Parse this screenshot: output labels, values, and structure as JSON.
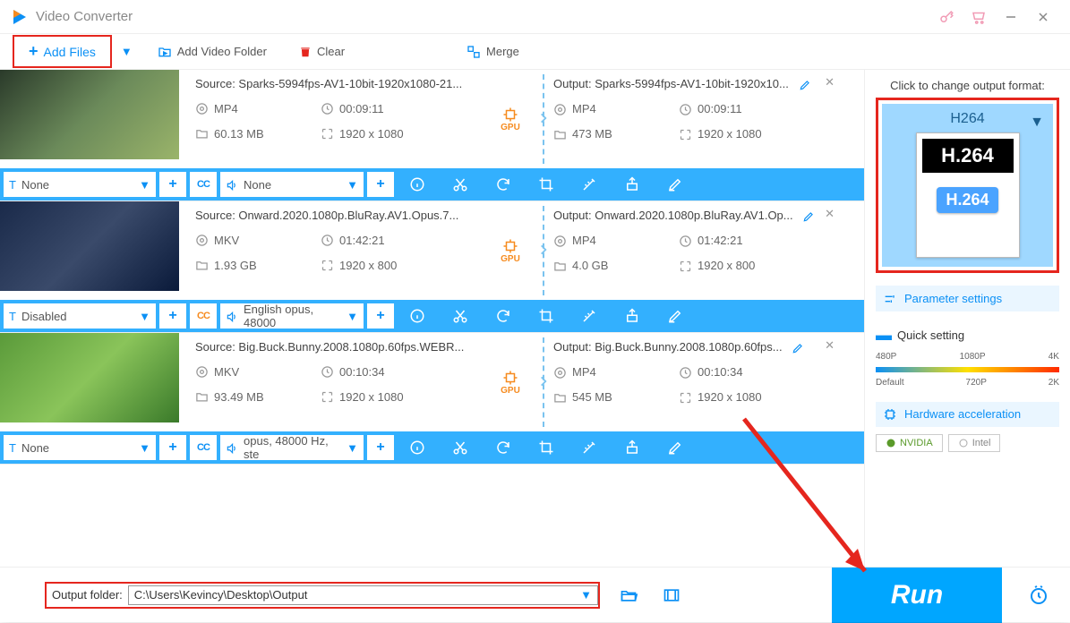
{
  "app": {
    "title": "Video Converter"
  },
  "toolbar": {
    "addFiles": "Add Files",
    "addFolder": "Add Video Folder",
    "clear": "Clear",
    "merge": "Merge"
  },
  "items": [
    {
      "source": {
        "label": "Source: Sparks-5994fps-AV1-10bit-1920x1080-21...",
        "format": "MP4",
        "duration": "00:09:11",
        "size": "60.13 MB",
        "res": "1920 x 1080"
      },
      "output": {
        "label": "Output: Sparks-5994fps-AV1-10bit-1920x10...",
        "format": "MP4",
        "duration": "00:09:11",
        "size": "473 MB",
        "res": "1920 x 1080"
      },
      "gpu": "GPU",
      "bar": {
        "subtitle": "None",
        "audio": "None"
      }
    },
    {
      "source": {
        "label": "Source: Onward.2020.1080p.BluRay.AV1.Opus.7...",
        "format": "MKV",
        "duration": "01:42:21",
        "size": "1.93 GB",
        "res": "1920 x 800"
      },
      "output": {
        "label": "Output: Onward.2020.1080p.BluRay.AV1.Op...",
        "format": "MP4",
        "duration": "01:42:21",
        "size": "4.0 GB",
        "res": "1920 x 800"
      },
      "gpu": "GPU",
      "bar": {
        "subtitle": "Disabled",
        "audio": "English opus, 48000"
      }
    },
    {
      "source": {
        "label": "Source: Big.Buck.Bunny.2008.1080p.60fps.WEBR...",
        "format": "MKV",
        "duration": "00:10:34",
        "size": "93.49 MB",
        "res": "1920 x 1080"
      },
      "output": {
        "label": "Output: Big.Buck.Bunny.2008.1080p.60fps...",
        "format": "MP4",
        "duration": "00:10:34",
        "size": "545 MB",
        "res": "1920 x 1080"
      },
      "gpu": "GPU",
      "bar": {
        "subtitle": "None",
        "audio": "opus, 48000 Hz, ste"
      }
    }
  ],
  "right": {
    "title": "Click to change output format:",
    "formatName": "H264",
    "cardTop": "H.264",
    "cardBot": "H.264",
    "param": "Parameter settings",
    "quick": "Quick setting",
    "ticks1": [
      "480P",
      "1080P",
      "4K"
    ],
    "ticks2": [
      "Default",
      "720P",
      "2K"
    ],
    "hw": "Hardware acceleration",
    "vendors": {
      "nvidia": "NVIDIA",
      "intel": "Intel"
    }
  },
  "bottom": {
    "label": "Output folder:",
    "path": "C:\\Users\\Kevincy\\Desktop\\Output",
    "run": "Run"
  }
}
